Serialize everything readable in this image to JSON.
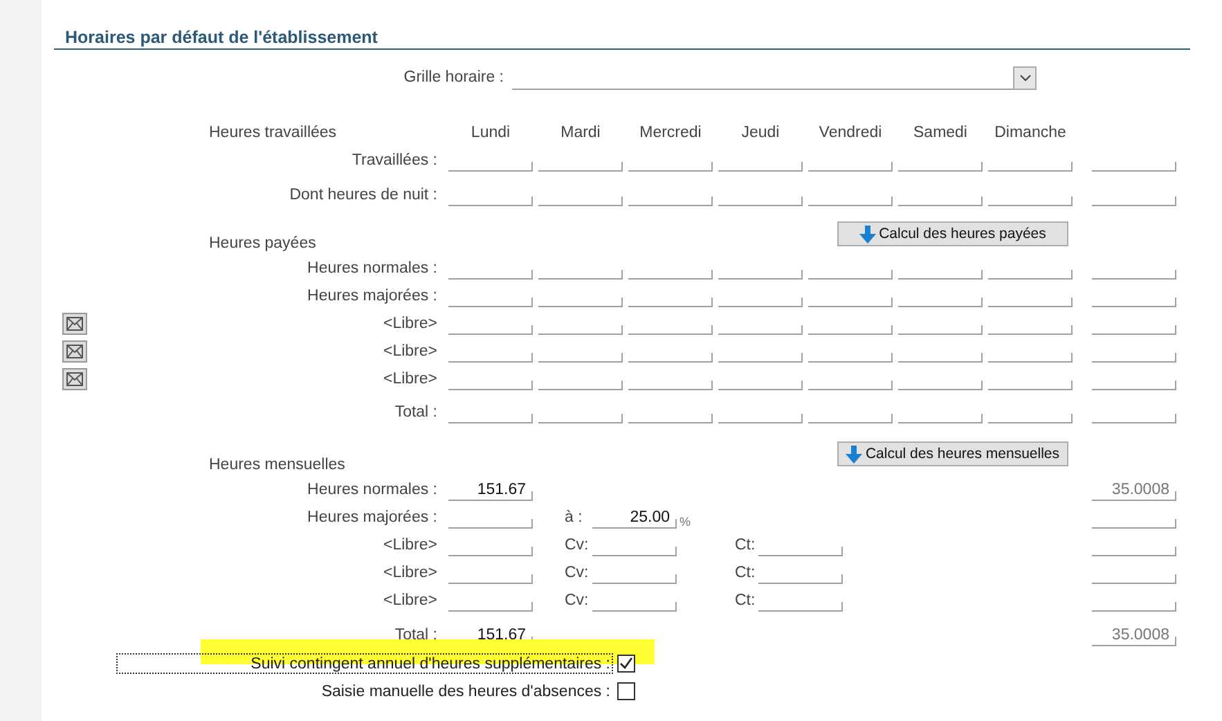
{
  "section_title": "Horaires par défaut de l'établissement",
  "schedule_grid": {
    "label": "Grille horaire :"
  },
  "worked": {
    "heading": "Heures travaillées",
    "days": [
      "Lundi",
      "Mardi",
      "Mercredi",
      "Jeudi",
      "Vendredi",
      "Samedi",
      "Dimanche"
    ],
    "rows": [
      {
        "label": "Travaillées :"
      },
      {
        "label": "Dont heures de nuit :"
      }
    ]
  },
  "paid": {
    "heading": "Heures payées",
    "button": "Calcul des heures payées",
    "rows": [
      {
        "label": "Heures normales :",
        "kind": "plain"
      },
      {
        "label": "Heures majorées :",
        "kind": "plain"
      },
      {
        "label": "<Libre>",
        "kind": "mail"
      },
      {
        "label": "<Libre>",
        "kind": "mail"
      },
      {
        "label": "<Libre>",
        "kind": "mail"
      },
      {
        "label": "Total :",
        "kind": "total"
      }
    ]
  },
  "monthly": {
    "heading": "Heures mensuelles",
    "button": "Calcul des heures mensuelles",
    "rows": [
      {
        "kind": "value",
        "label": "Heures normales :",
        "value": "151.67",
        "weekly": "35.0008"
      },
      {
        "kind": "rate",
        "label": "Heures majorées :",
        "rate_label": "à :",
        "rate": "25.00",
        "unit": "%"
      },
      {
        "kind": "free",
        "label": "<Libre>",
        "cv_label": "Cv:",
        "ct_label": "Ct:"
      },
      {
        "kind": "free",
        "label": "<Libre>",
        "cv_label": "Cv:",
        "ct_label": "Ct:"
      },
      {
        "kind": "free",
        "label": "<Libre>",
        "cv_label": "Cv:",
        "ct_label": "Ct:"
      },
      {
        "kind": "total",
        "label": "Total :",
        "value": "151.67",
        "weekly": "35.0008"
      }
    ]
  },
  "options": [
    {
      "label": "Suivi contingent annuel d'heures supplémentaires :",
      "checked": true,
      "focused": true,
      "highlighted": true
    },
    {
      "label": "Saisie manuelle des heures d'absences :",
      "checked": false,
      "focused": false,
      "highlighted": false
    }
  ]
}
